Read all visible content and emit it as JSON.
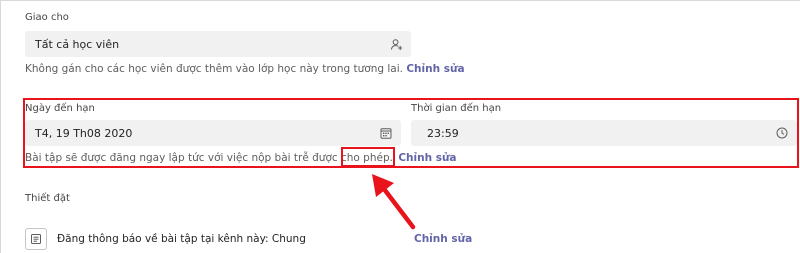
{
  "assign_to": {
    "label": "Giao cho",
    "value": "Tất cả học viên",
    "icon": "add-person-icon",
    "note": "Không gán cho các học viên được thêm vào lớp học này trong tương lai.",
    "edit_label": "Chỉnh sửa"
  },
  "due_date": {
    "label": "Ngày đến hạn",
    "value": "T4, 19 Th08 2020",
    "icon": "calendar-icon"
  },
  "due_time": {
    "label": "Thời gian đến hạn",
    "value": "23:59",
    "icon": "clock-icon"
  },
  "late_note": {
    "text": "Bài tập sẽ được đăng ngay lập tức với việc nộp bài trễ được cho phép.",
    "edit_label": "Chỉnh sửa"
  },
  "settings": {
    "label": "Thiết đặt",
    "channel_prefix": "Đăng thông báo về bài tập tại kênh này:",
    "channel_name": "Chung",
    "edit_label": "Chỉnh sửa",
    "icon": "announcement-icon"
  },
  "colors": {
    "accent": "#6264a7",
    "highlight": "#e8131b",
    "field_bg": "#f1f1f1"
  }
}
